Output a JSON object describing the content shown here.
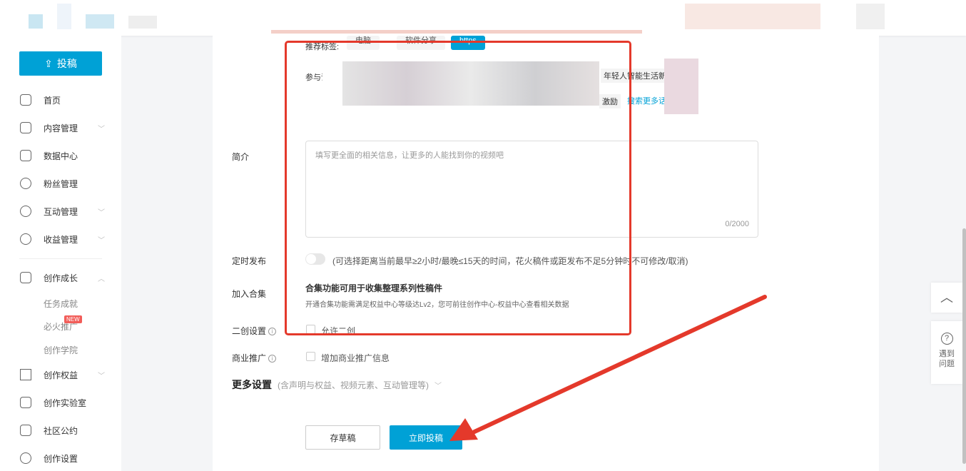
{
  "sidebar": {
    "upload_label": "投稿",
    "items": [
      {
        "label": "首页"
      },
      {
        "label": "内容管理"
      },
      {
        "label": "数据中心"
      },
      {
        "label": "粉丝管理"
      },
      {
        "label": "互动管理"
      },
      {
        "label": "收益管理"
      },
      {
        "label": "创作成长"
      },
      {
        "label": "任务成就"
      },
      {
        "label": "必火推广",
        "badge": "NEW"
      },
      {
        "label": "创作学院"
      },
      {
        "label": "创作权益"
      },
      {
        "label": "创作实验室"
      },
      {
        "label": "社区公约"
      },
      {
        "label": "创作设置"
      }
    ]
  },
  "form": {
    "tags_label": "推荐标签:",
    "tags": [
      "电脑",
      "软件分享",
      "https"
    ],
    "topic_label": "参与话题:",
    "topic_partial_1": "年轻人智能生活新站",
    "topic_partial_2": "激励",
    "search_more_topics": "搜索更多话题",
    "intro_label": "简介",
    "intro_placeholder": "填写更全面的相关信息，让更多的人能找到你的视频吧",
    "intro_count": "0/2000",
    "schedule_label": "定时发布",
    "schedule_hint": "(可选择距离当前最早≥2小时/最晚≤15天的时间，花火稿件或距发布不足5分钟时不可修改/取消)",
    "collection_label": "加入合集",
    "collection_title": "合集功能可用于收集整理系列性稿件",
    "collection_desc": "开通合集功能需满足权益中心等级达Lv2，您可前往创作中心-权益中心查看相关数据",
    "remix_label": "二创设置",
    "remix_option": "允许二创",
    "commercial_label": "商业推广",
    "commercial_option": "增加商业推广信息",
    "more_settings": "更多设置",
    "more_settings_hint": "(含声明与权益、视频元素、互动管理等)",
    "save_draft": "存草稿",
    "submit": "立即投稿"
  },
  "float": {
    "help_label": "遇到问题"
  },
  "colors": {
    "accent": "#00a1d6",
    "annotation": "#e4392b"
  }
}
